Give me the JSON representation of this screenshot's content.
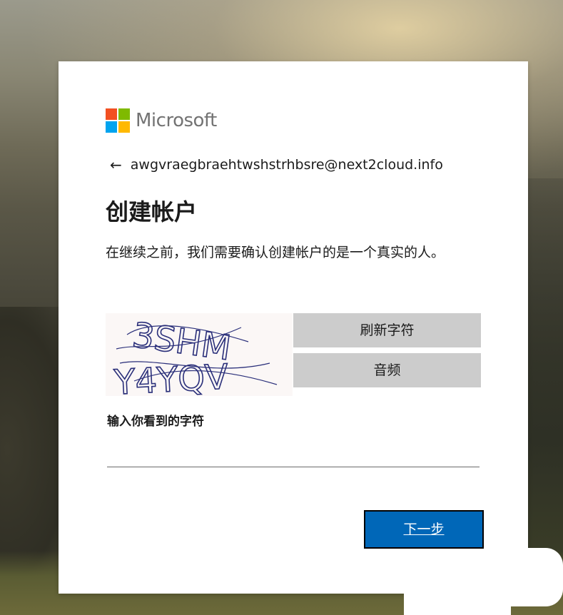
{
  "brand": {
    "name": "Microsoft",
    "colors": {
      "red": "#f25022",
      "green": "#7fba00",
      "blue": "#00a4ef",
      "yellow": "#ffb900"
    }
  },
  "identity": {
    "back_icon": "left-arrow-icon",
    "email": "awgvraegbraehtwshstrhbsre@next2cloud.info"
  },
  "title": "创建帐户",
  "description": "在继续之前，我们需要确认创建帐户的是一个真实的人。",
  "captcha": {
    "characters_line1": "3SHM",
    "characters_line2": "Y4YQV",
    "refresh_label": "刷新字符",
    "audio_label": "音频"
  },
  "input": {
    "label": "输入你看到的字符",
    "value": "",
    "placeholder": ""
  },
  "next_button": {
    "label": "下一步",
    "color": "#0067b8"
  }
}
